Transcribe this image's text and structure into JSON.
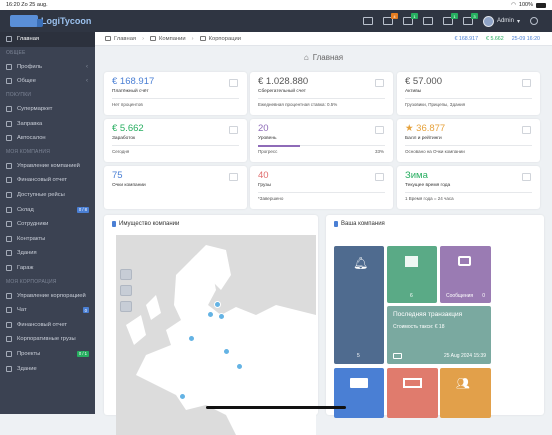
{
  "status": {
    "time": "16:20",
    "date": "Zo 25 aug.",
    "battery": "100%"
  },
  "app": {
    "logo_text": "LogiTycoon"
  },
  "topbar": {
    "badges": [
      {
        "count": "4",
        "color": "#e67e22"
      },
      {
        "count": "1",
        "color": "#27ae60"
      },
      {
        "count": "1",
        "color": "#27ae60"
      },
      {
        "count": "3",
        "color": "#27ae60"
      }
    ],
    "user": "Admin"
  },
  "sidebar": {
    "items": [
      {
        "label": "Главная",
        "active": true
      },
      {
        "section": "ОБЩЕЕ"
      },
      {
        "label": "Профиль",
        "arrow": "‹"
      },
      {
        "label": "Общее",
        "arrow": "‹"
      },
      {
        "section": "ПОКУПКИ"
      },
      {
        "label": "Супермаркет"
      },
      {
        "label": "Заправка"
      },
      {
        "label": "Автосалон"
      },
      {
        "section": "МОЯ КОМПАНИЯ"
      },
      {
        "label": "Управление компанией"
      },
      {
        "label": "Финансовый отчет"
      },
      {
        "label": "Доступные рейсы"
      },
      {
        "label": "Склад",
        "badge": "0 / 8",
        "badge_color": "#4a7fd4"
      },
      {
        "label": "Сотрудники"
      },
      {
        "label": "Контракты"
      },
      {
        "label": "Здания"
      },
      {
        "label": "Гараж"
      },
      {
        "section": "МОЯ КОРПОРАЦИЯ"
      },
      {
        "label": "Управление корпорацией"
      },
      {
        "label": "Чат",
        "badge": "0",
        "badge_color": "#4a7fd4"
      },
      {
        "label": "Финансовый отчет"
      },
      {
        "label": "Корпоративные грузы"
      },
      {
        "label": "Проекты",
        "badge": "0 / 1",
        "badge_color": "#27ae60"
      },
      {
        "label": "Здание"
      }
    ]
  },
  "breadcrumb": {
    "items": [
      "Главная",
      "Компании",
      "Корпорации"
    ],
    "right": [
      "€ 168.917",
      "€ 5.662",
      "25-09 16:20"
    ]
  },
  "page_title": "Главная",
  "cards": [
    {
      "value": "€ 168.917",
      "value_color": "#4a7fd4",
      "label": "Платёжный счёт",
      "foot": "Нет процентов",
      "footr": ""
    },
    {
      "value": "€ 1.028.880",
      "value_color": "#555",
      "label": "Сберегательный счет",
      "foot": "Ежедневная процентная ставка: 0.5%",
      "footr": ""
    },
    {
      "value": "€ 57.000",
      "value_color": "#555",
      "label": "Активы",
      "foot": "Грузовики, Прицепы, Здания",
      "footr": ""
    },
    {
      "value": "€ 5.662",
      "value_color": "#27ae60",
      "label": "Заработок",
      "foot": "Сегодня",
      "footr": ""
    },
    {
      "value": "20",
      "value_color": "#8e6bb8",
      "label": "Уровень",
      "foot": "Прогресс",
      "footr": "33%",
      "progress": 0.33
    },
    {
      "value": "★ 36.877",
      "value_color": "#e6a23c",
      "label": "Балл и рейтинги",
      "foot": "Основано на Очки компании",
      "footr": ""
    },
    {
      "value": "75",
      "value_color": "#4a7fd4",
      "label": "Очки компании",
      "foot": "",
      "footr": ""
    },
    {
      "value": "40",
      "value_color": "#e06c6c",
      "label": "Грузы",
      "foot": "*Завершено",
      "footr": ""
    },
    {
      "value": "Зима",
      "value_color": "#27ae60",
      "label": "Текущее время года",
      "foot": "1 Время года = 24 часа",
      "footr": ""
    }
  ],
  "map_panel": {
    "title": "Имущество компании"
  },
  "company_panel": {
    "title": "Ваша компания",
    "tiles": [
      {
        "count": "5",
        "color": "#4f6b8f"
      },
      {
        "count": "6",
        "color": "#5aaa86"
      },
      {
        "label": "Сообщения",
        "count": "0",
        "color": "#9a7bb3"
      },
      {
        "title": "Последняя транзакция",
        "line": "Стоимость такси: € 18",
        "date": "25 Aug 2024 15:39",
        "color": "#7aa9a0"
      },
      {
        "color": "#4a7fd4"
      },
      {
        "color": "#e07b6d"
      },
      {
        "color": "#e2a04a"
      }
    ]
  }
}
